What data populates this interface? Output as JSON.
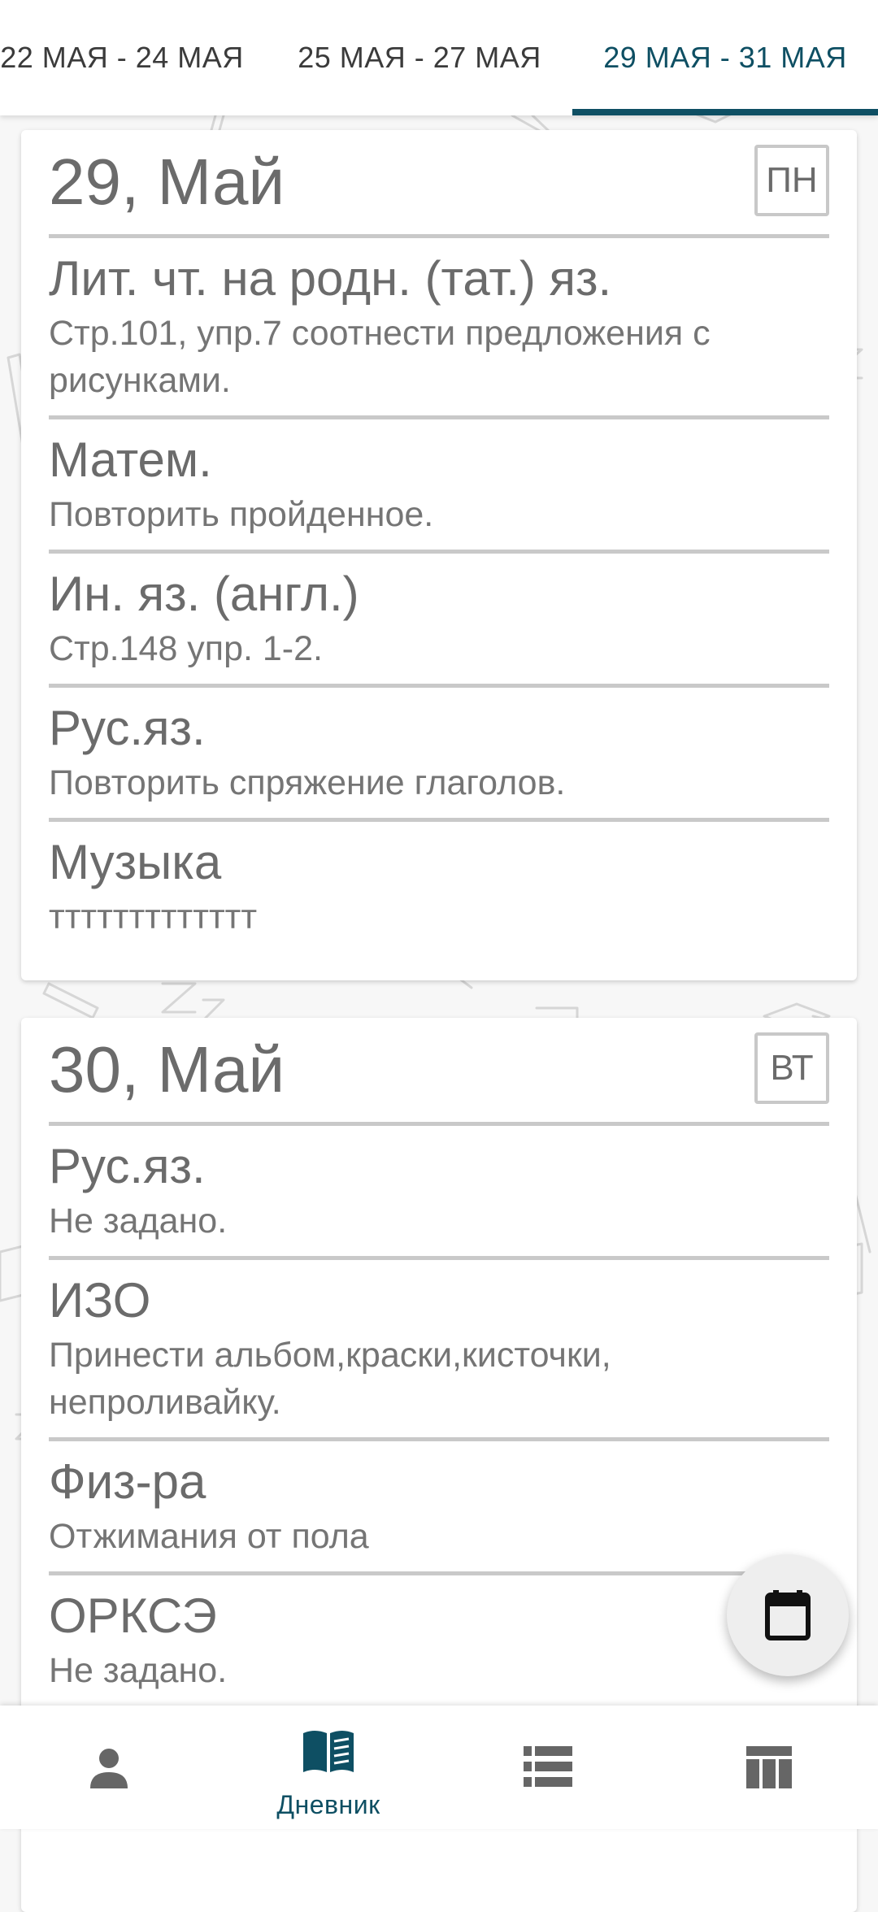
{
  "tabs": [
    {
      "label": "22 МАЯ - 24 МАЯ"
    },
    {
      "label": "25 МАЯ - 27 МАЯ"
    },
    {
      "label": "29 МАЯ - 31 МАЯ"
    }
  ],
  "selected_tab": "29 МАЯ - 31 МАЯ",
  "days": [
    {
      "date": "29, Май",
      "weekday": "ПН",
      "lessons": [
        {
          "subject": "Лит. чт. на родн. (тат.) яз.",
          "homework": "Стр.101, упр.7 соотнести предложения с рисунками."
        },
        {
          "subject": "Матем.",
          "homework": "Повторить пройденное."
        },
        {
          "subject": "Ин. яз. (англ.)",
          "homework": "Стр.148 упр. 1-2."
        },
        {
          "subject": "Рус.яз.",
          "homework": "Повторить спряжение глаголов."
        },
        {
          "subject": "Музыка",
          "homework": "ттттттттттттт"
        }
      ]
    },
    {
      "date": "30, Май",
      "weekday": "ВТ",
      "lessons": [
        {
          "subject": "Рус.яз.",
          "homework": "Не задано."
        },
        {
          "subject": "ИЗО",
          "homework": "Принести альбом,краски,кисточки, непроливайку."
        },
        {
          "subject": "Физ-ра",
          "homework": "Отжимания от пола"
        },
        {
          "subject": "ОРКСЭ",
          "homework": "Не задано."
        }
      ]
    }
  ],
  "fab": {
    "icon": "calendar-icon"
  },
  "bottom_nav": {
    "items": [
      {
        "icon": "person-icon",
        "label": ""
      },
      {
        "icon": "book-icon",
        "label": "Дневник",
        "active": true
      },
      {
        "icon": "list-icon",
        "label": ""
      },
      {
        "icon": "table-icon",
        "label": ""
      }
    ]
  },
  "colors": {
    "accent": "#0e4f63",
    "text": "#6b6b6b",
    "divider": "#c9c9c9",
    "background": "#f7f7f7"
  }
}
